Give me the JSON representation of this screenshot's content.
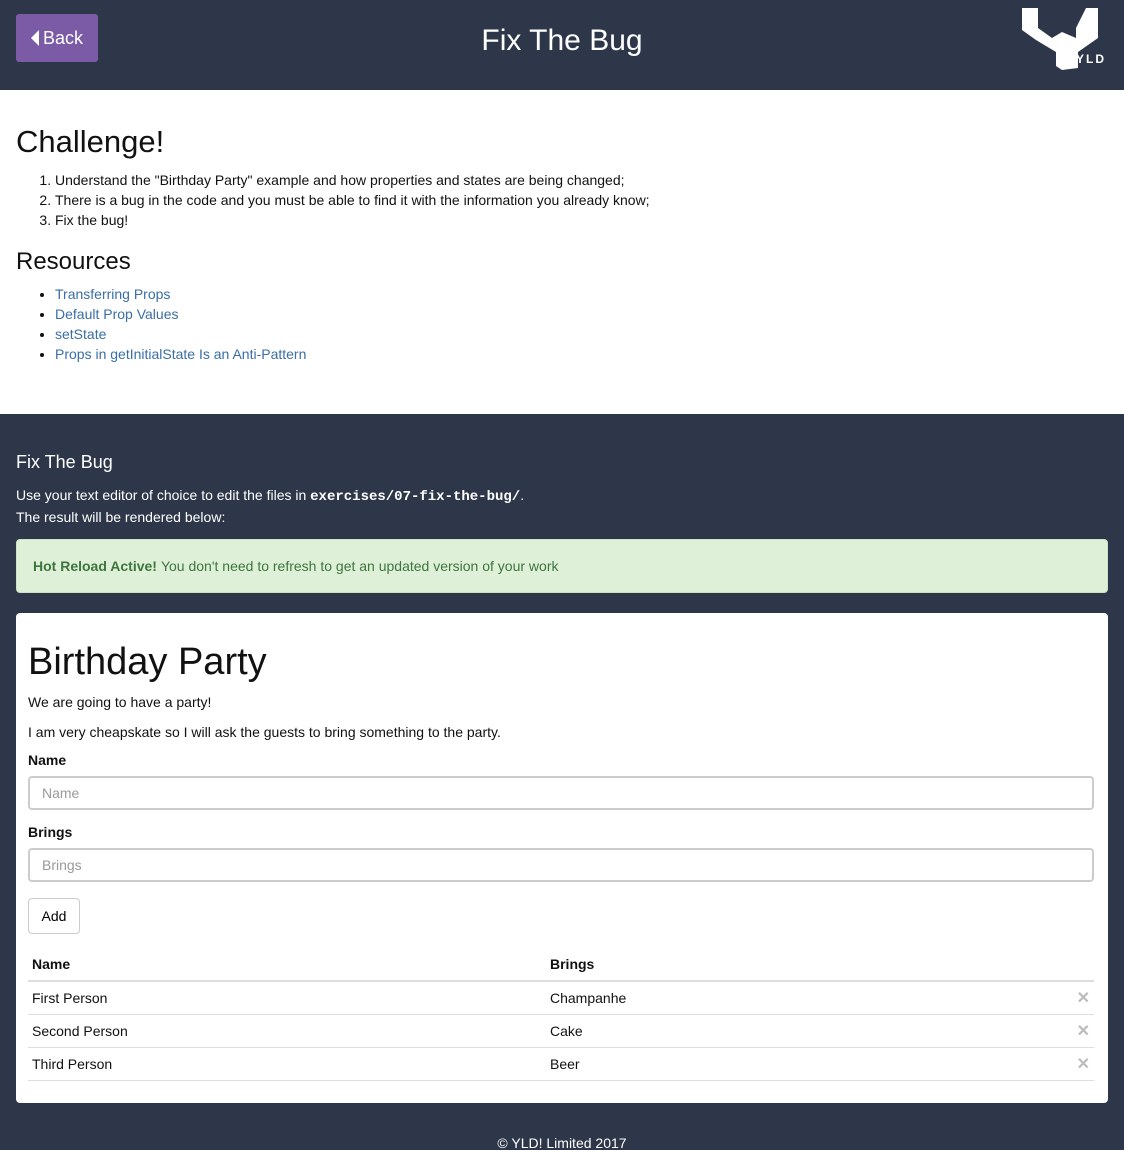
{
  "header": {
    "back_label": "Back",
    "title": "Fix The Bug",
    "logo_text": "YLD"
  },
  "challenge": {
    "title": "Challenge!",
    "items": [
      "Understand the \"Birthday Party\" example and how properties and states are being changed;",
      "There is a bug in the code and you must be able to find it with the information you already know;",
      "Fix the bug!"
    ]
  },
  "resources": {
    "title": "Resources",
    "links": [
      "Transferring Props",
      "Default Prop Values",
      "setState",
      "Props in getInitialState Is an Anti-Pattern"
    ]
  },
  "exercise": {
    "title": "Fix The Bug",
    "line1_prefix": "Use your text editor of choice to edit the files in ",
    "path": "exercises/07-fix-the-bug/",
    "line1_suffix": ".",
    "line2": "The result will be rendered below:"
  },
  "alert": {
    "strong": "Hot Reload Active!",
    "text": "You don't need to refresh to get an updated version of your work",
    "color": "#dff0d8"
  },
  "party": {
    "title": "Birthday Party",
    "para1": "We are going to have a party!",
    "para2": "I am very cheapskate so I will ask the guests to bring something to the party.",
    "name_label": "Name",
    "name_placeholder": "Name",
    "brings_label": "Brings",
    "brings_placeholder": "Brings",
    "add_label": "Add",
    "table": {
      "headers": [
        "Name",
        "Brings"
      ],
      "rows": [
        {
          "name": "First Person",
          "brings": "Champanhe"
        },
        {
          "name": "Second Person",
          "brings": "Cake"
        },
        {
          "name": "Third Person",
          "brings": "Beer"
        }
      ]
    }
  },
  "footer": {
    "text": "© YLD! Limited 2017"
  },
  "colors": {
    "header_bg": "#2e3749",
    "back_button": "#7b5aa6",
    "link": "#3a6ea5"
  }
}
